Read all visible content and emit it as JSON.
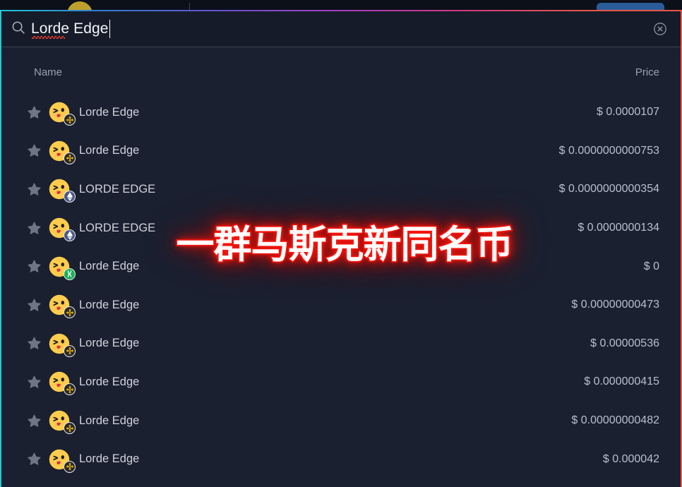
{
  "backdrop": {
    "avatar_label": "user-avatar",
    "action_button_label": ""
  },
  "search": {
    "icon": "search-icon",
    "value": "Lorde Edge",
    "placeholder": "Search",
    "spellcheck_word": "Lorde",
    "clear_icon": "circle-x-icon"
  },
  "table": {
    "columns": {
      "name": "Name",
      "price": "Price"
    },
    "rows": [
      {
        "star": "star-icon",
        "logo": "emoji-winking-face",
        "chain": "bnb",
        "chain_label": "Binance Smart Chain",
        "name": "Lorde Edge",
        "price": "$ 0.0000107"
      },
      {
        "star": "star-icon",
        "logo": "emoji-winking-face",
        "chain": "bnb",
        "chain_label": "Binance Smart Chain",
        "name": "Lorde Edge",
        "price": "$ 0.0000000000753"
      },
      {
        "star": "star-icon",
        "logo": "emoji-winking-face",
        "chain": "eth",
        "chain_label": "Ethereum",
        "name": "LORDE EDGE",
        "price": "$ 0.0000000000354"
      },
      {
        "star": "star-icon",
        "logo": "emoji-winking-face",
        "chain": "eth",
        "chain_label": "Ethereum",
        "name": "LORDE EDGE",
        "price": "$ 0.0000000134"
      },
      {
        "star": "star-icon",
        "logo": "emoji-winking-face",
        "chain": "heco",
        "chain_label": "HECO Chain",
        "name": "Lorde Edge",
        "price": "$ 0"
      },
      {
        "star": "star-icon",
        "logo": "emoji-winking-face",
        "chain": "bnb",
        "chain_label": "Binance Smart Chain",
        "name": "Lorde Edge",
        "price": "$ 0.00000000473"
      },
      {
        "star": "star-icon",
        "logo": "emoji-winking-face",
        "chain": "bnb",
        "chain_label": "Binance Smart Chain",
        "name": "Lorde Edge",
        "price": "$ 0.00000536"
      },
      {
        "star": "star-icon",
        "logo": "emoji-winking-face",
        "chain": "bnb",
        "chain_label": "Binance Smart Chain",
        "name": "Lorde Edge",
        "price": "$ 0.000000415"
      },
      {
        "star": "star-icon",
        "logo": "emoji-winking-face",
        "chain": "bnb",
        "chain_label": "Binance Smart Chain",
        "name": "Lorde Edge",
        "price": "$ 0.00000000482"
      },
      {
        "star": "star-icon",
        "logo": "emoji-winking-face",
        "chain": "bnb",
        "chain_label": "Binance Smart Chain",
        "name": "Lorde Edge",
        "price": "$ 0.000042"
      }
    ]
  },
  "caption": {
    "text": "一群马斯克新同名币",
    "glow_color": "#f01a14",
    "fill_color": "#ffffff"
  },
  "theme": {
    "panel_bg": "#1a2030",
    "search_bg": "#161b29",
    "border_left": "#21c8d8",
    "border_right": "#e8574a",
    "text_primary": "#f2f4f8",
    "text_secondary": "#cfd3dc",
    "text_muted": "#9aa0ae"
  }
}
